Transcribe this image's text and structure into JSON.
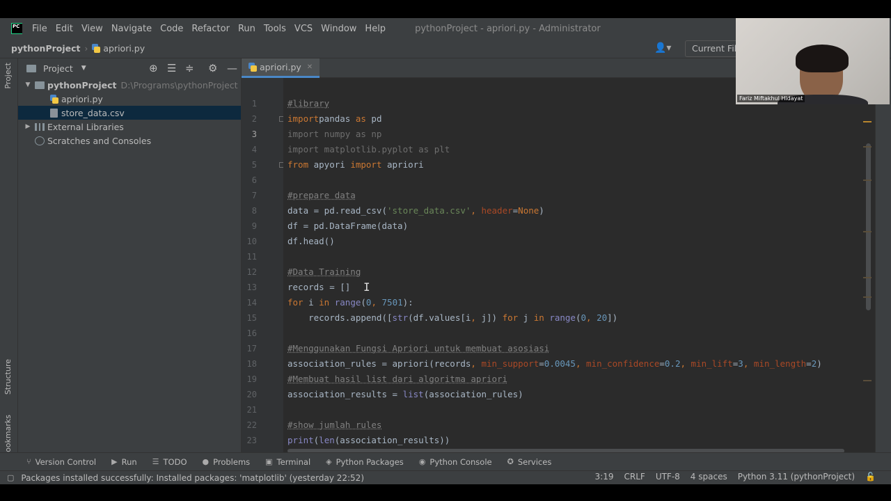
{
  "menu": {
    "items": [
      "File",
      "Edit",
      "View",
      "Navigate",
      "Code",
      "Refactor",
      "Run",
      "Tools",
      "VCS",
      "Window",
      "Help"
    ],
    "window_title": "pythonProject - apriori.py - Administrator"
  },
  "navbar": {
    "project": "pythonProject",
    "file": "apriori.py",
    "run_config": "Current File"
  },
  "side_tabs": {
    "project": "Project",
    "structure": "Structure",
    "bookmarks": "Bookmarks"
  },
  "project_panel": {
    "title": "Project",
    "tree": [
      {
        "label": "pythonProject",
        "hint": "D:\\Programs\\pythonProject"
      },
      {
        "label": "apriori.py"
      },
      {
        "label": "store_data.csv"
      },
      {
        "label": "External Libraries"
      },
      {
        "label": "Scratches and Consoles"
      }
    ]
  },
  "editor": {
    "tab": "apriori.py",
    "line_numbers": [
      "1",
      "2",
      "3",
      "4",
      "5",
      "6",
      "7",
      "8",
      "9",
      "10",
      "11",
      "12",
      "13",
      "14",
      "15",
      "16",
      "17",
      "18",
      "19",
      "20",
      "21",
      "22",
      "23"
    ],
    "current_line": "3"
  },
  "toolwindows": [
    "Version Control",
    "Run",
    "TODO",
    "Problems",
    "Terminal",
    "Python Packages",
    "Python Console",
    "Services"
  ],
  "status": {
    "message": "Packages installed successfully: Installed packages: 'matplotlib' (yesterday 22:52)",
    "position": "3:19",
    "line_sep": "CRLF",
    "encoding": "UTF-8",
    "indent": "4 spaces",
    "interpreter": "Python 3.11 (pythonProject)"
  },
  "webcam": {
    "name": "Fariz Miftakhul Hidayat"
  }
}
